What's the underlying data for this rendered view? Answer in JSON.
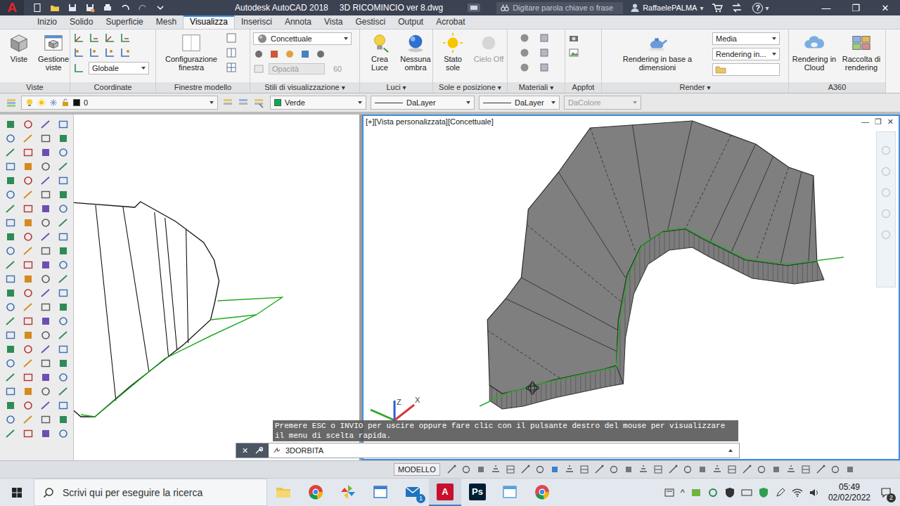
{
  "title_bar": {
    "logo": "A",
    "product": "Autodesk AutoCAD 2018",
    "file": "3D RICOMINCIO ver 8.dwg",
    "search_placeholder": "Digitare parola chiave o frase",
    "user": "RaffaelePALMA",
    "dropdown_arrow": "▾",
    "help": "?",
    "window_buttons": [
      "—",
      "❐",
      "✕"
    ]
  },
  "ribbon": {
    "tabs": [
      {
        "label": "Inizio",
        "selected": false
      },
      {
        "label": "Solido",
        "selected": false
      },
      {
        "label": "Superficie",
        "selected": false
      },
      {
        "label": "Mesh",
        "selected": false
      },
      {
        "label": "Visualizza",
        "selected": true
      },
      {
        "label": "Inserisci",
        "selected": false
      },
      {
        "label": "Annota",
        "selected": false
      },
      {
        "label": "Vista",
        "selected": false
      },
      {
        "label": "Gestisci",
        "selected": false
      },
      {
        "label": "Output",
        "selected": false
      },
      {
        "label": "Acrobat",
        "selected": false
      }
    ],
    "panels": [
      {
        "kind": "views",
        "title": "Viste",
        "buttons": [
          {
            "label": "Viste",
            "disabled": false
          },
          {
            "label": "Gestione viste",
            "disabled": false
          }
        ]
      },
      {
        "kind": "ucs",
        "title": "Coordinate",
        "dropdown": "Globale"
      },
      {
        "kind": "viewports",
        "title": "Finestre modello",
        "buttons": [
          {
            "label": "Configurazione finestra",
            "disabled": false
          }
        ]
      },
      {
        "kind": "visual-styles",
        "title": "Stili di visualizzazione",
        "arrow": "▾",
        "dropdown": "Concettuale",
        "field": {
          "label": "Opacità",
          "value": "60",
          "disabled": true
        }
      },
      {
        "kind": "lights",
        "title": "Luci",
        "arrow": "▾",
        "buttons": [
          {
            "label": "Crea Luce",
            "disabled": false
          },
          {
            "label": "Nessuna ombra",
            "disabled": false
          }
        ]
      },
      {
        "kind": "sun",
        "title": "Sole e posizione",
        "arrow": "▾",
        "buttons": [
          {
            "label": "Stato sole",
            "disabled": false
          },
          {
            "label": "Cielo Off",
            "disabled": true
          }
        ]
      },
      {
        "kind": "materials",
        "title": "Materiali",
        "arrow": "▾"
      },
      {
        "kind": "appfot",
        "title": "Appfot"
      },
      {
        "kind": "render",
        "title": "Render",
        "arrow": "▾",
        "buttons": [
          {
            "label": "Rendering in base a dimensioni",
            "disabled": false
          }
        ],
        "dropdowns": [
          "Media",
          "Rendering in..."
        ]
      },
      {
        "kind": "a360",
        "title": "A360",
        "buttons": [
          {
            "label": "Rendering in Cloud",
            "disabled": false
          },
          {
            "label": "Raccolta di rendering",
            "disabled": false
          }
        ]
      }
    ]
  },
  "properties": {
    "layer": "0",
    "color": {
      "name": "Verde",
      "swatch": "#00b050"
    },
    "linetype": "DaLayer",
    "lineweight": "DaLayer",
    "plot_style": {
      "label": "DaColore",
      "disabled": true
    }
  },
  "viewports": {
    "left": {
      "active": false
    },
    "right": {
      "label": "[+][Vista personalizzata][Concettuale]",
      "active": true,
      "controls": [
        "—",
        "❐",
        "✕"
      ],
      "axes": [
        "Z",
        "X"
      ]
    }
  },
  "command_line": {
    "hint": "Premere ESC o INVIO per uscire oppure fare clic con il pulsante destro del mouse per visualizzare il menu di scelta rapida.",
    "close": "×",
    "command": "3DORBITA"
  },
  "status_bar": {
    "mode": "MODELLO"
  },
  "taskbar": {
    "search": "Scrivi qui per eseguire la ricerca",
    "apps": [
      {
        "kind": "folder",
        "color": "#f0c24b",
        "active": false
      },
      {
        "kind": "chrome",
        "color": "#db4437",
        "active": false
      },
      {
        "kind": "pinwheel",
        "color": "#7cb342",
        "active": false
      },
      {
        "kind": "window",
        "color": "#3d7dca",
        "active": false
      },
      {
        "kind": "mail",
        "color": "#1e73be",
        "active": false,
        "badge": "1"
      },
      {
        "kind": "letter",
        "text": "A",
        "color": "#c8102e",
        "active": true
      },
      {
        "kind": "letter",
        "text": "Ps",
        "color": "#001d34",
        "active": false
      },
      {
        "kind": "window",
        "color": "#5aa0d8",
        "active": false
      },
      {
        "kind": "chrome",
        "color": "#e0484b",
        "active": false
      }
    ],
    "tray_arrow": "^",
    "time": "05:49",
    "date": "02/02/2022",
    "notifications": "2"
  }
}
